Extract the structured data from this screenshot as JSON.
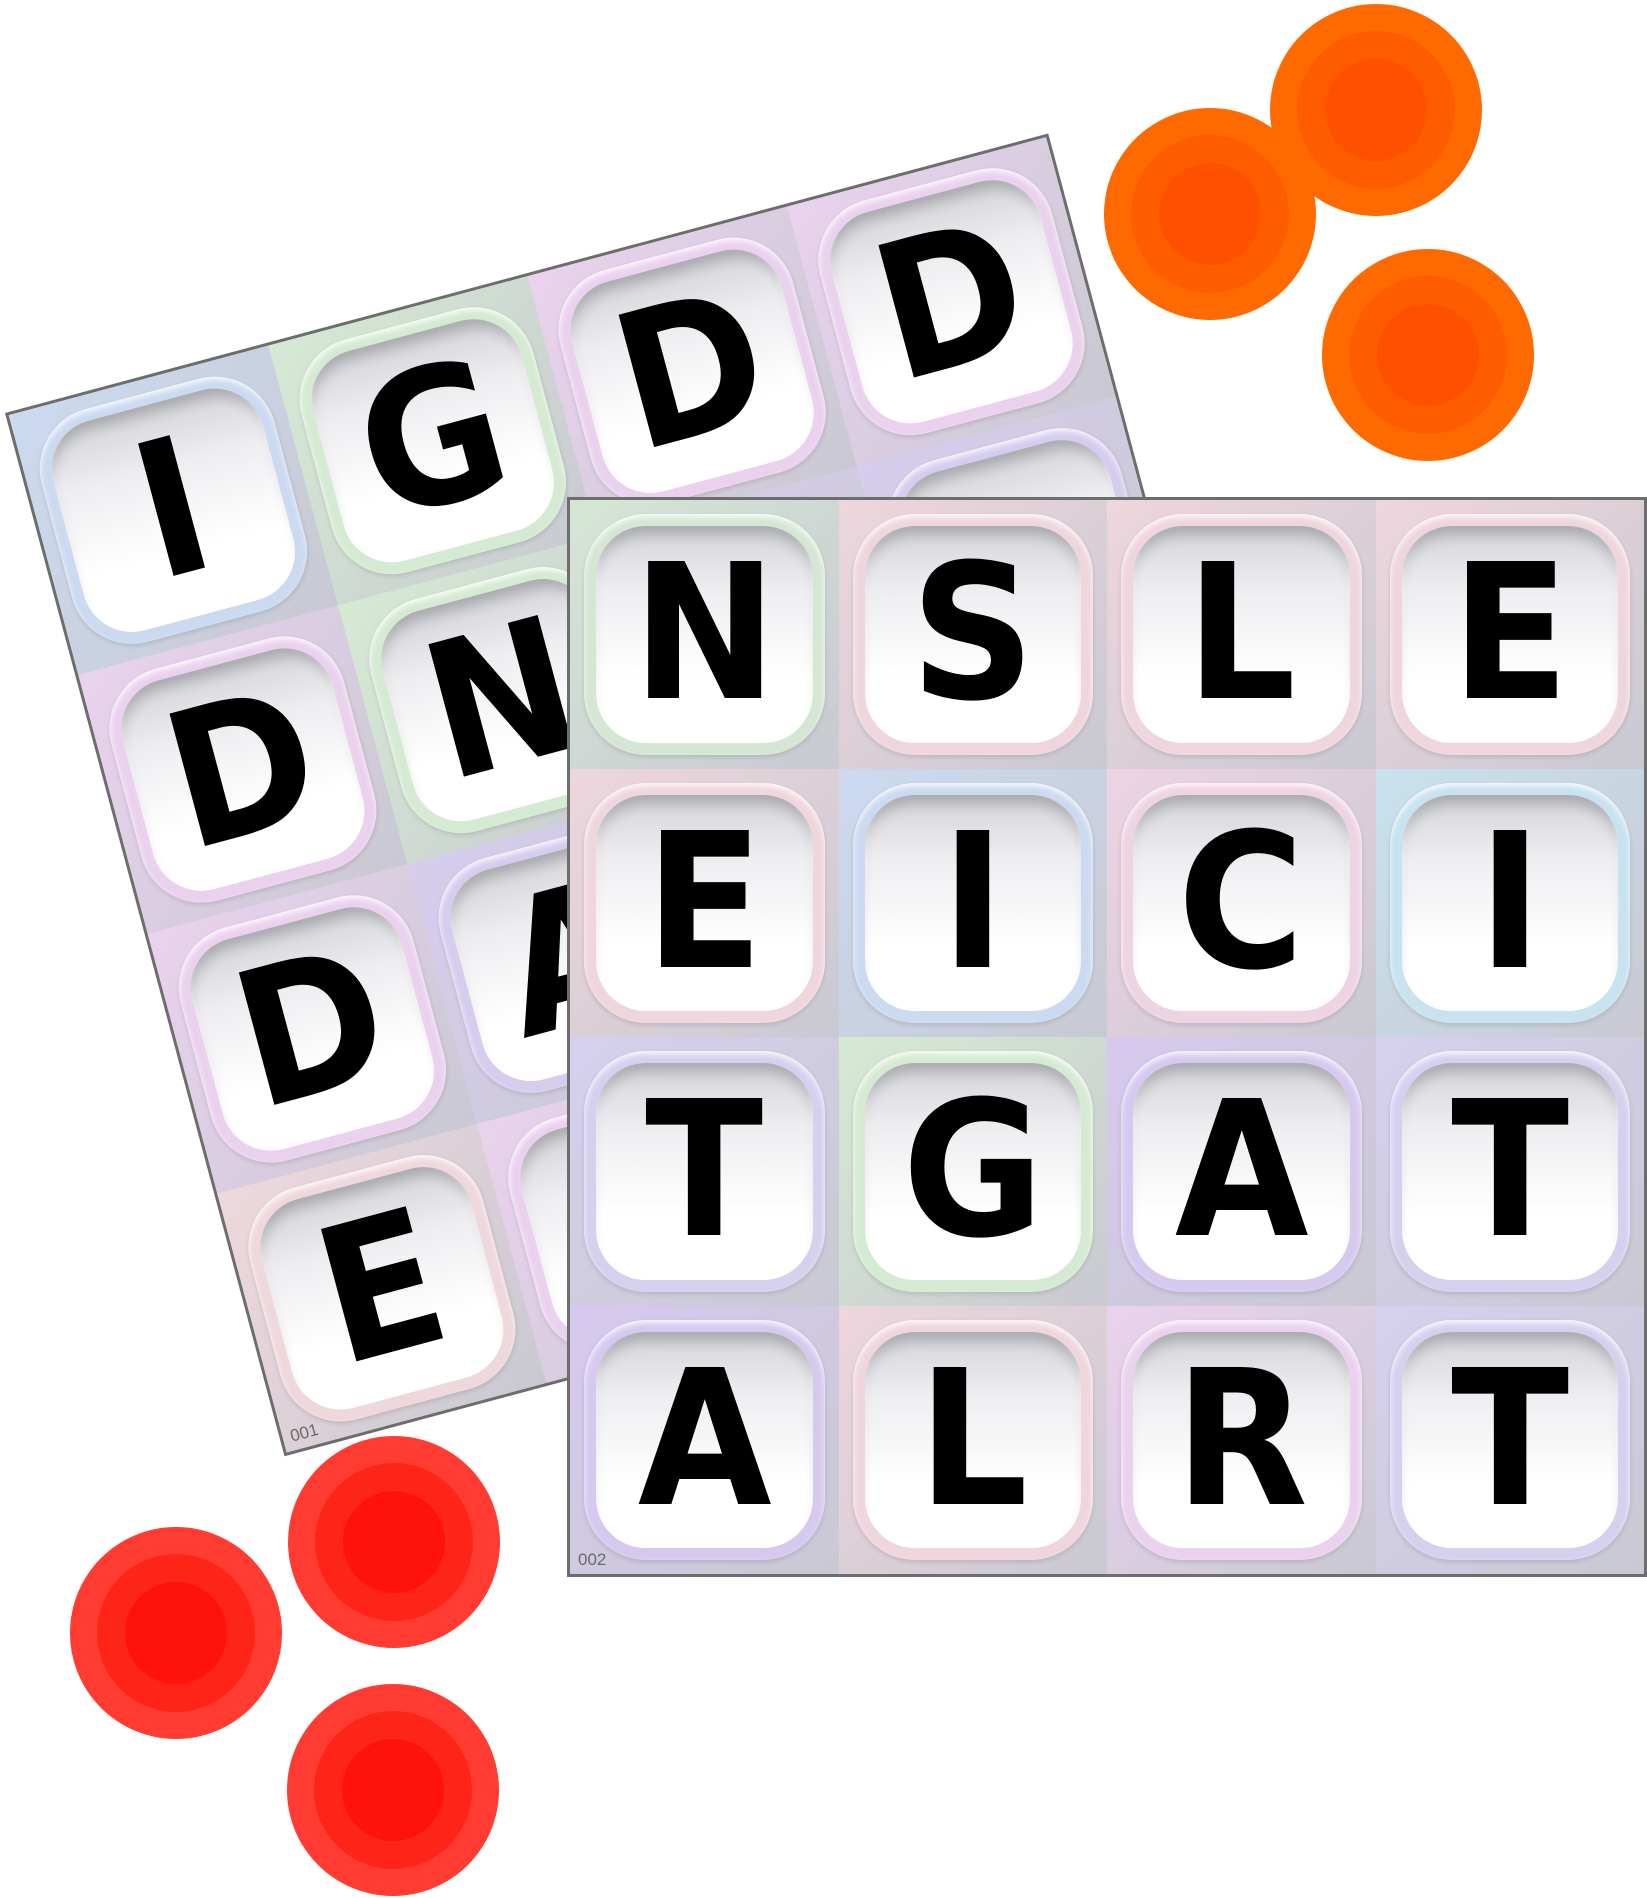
{
  "boards": [
    {
      "number": "001",
      "cells": [
        {
          "letter": "I",
          "color": "#cbdaf0"
        },
        {
          "letter": "G",
          "color": "#d5ead3"
        },
        {
          "letter": "D",
          "color": "#ead2ee"
        },
        {
          "letter": "D",
          "color": "#ead2ee"
        },
        {
          "letter": "D",
          "color": "#ead2ee"
        },
        {
          "letter": "N",
          "color": "#d5ead3"
        },
        {
          "letter": "",
          "color": "#d6cdee"
        },
        {
          "letter": "",
          "color": "#d6cdee"
        },
        {
          "letter": "D",
          "color": "#ead2ee"
        },
        {
          "letter": "A",
          "color": "#d6cdee"
        },
        {
          "letter": "",
          "color": "#e6d9de"
        },
        {
          "letter": "",
          "color": "#d6cdee"
        },
        {
          "letter": "E",
          "color": "#eed8dc"
        },
        {
          "letter": "",
          "color": "#ead2ee"
        },
        {
          "letter": "",
          "color": "#eed8dc"
        },
        {
          "letter": "",
          "color": "#d6cdee"
        }
      ]
    },
    {
      "number": "002",
      "cells": [
        {
          "letter": "N",
          "color": "#d5e6d5"
        },
        {
          "letter": "S",
          "color": "#eed6dc"
        },
        {
          "letter": "L",
          "color": "#eed6dc"
        },
        {
          "letter": "E",
          "color": "#eed6dc"
        },
        {
          "letter": "E",
          "color": "#eed6dc"
        },
        {
          "letter": "I",
          "color": "#cbdaf0"
        },
        {
          "letter": "C",
          "color": "#eed3e3"
        },
        {
          "letter": "I",
          "color": "#c8e2ef"
        },
        {
          "letter": "T",
          "color": "#d6d0ef"
        },
        {
          "letter": "G",
          "color": "#d5ead3"
        },
        {
          "letter": "A",
          "color": "#d6c9ef"
        },
        {
          "letter": "T",
          "color": "#d6d0ef"
        },
        {
          "letter": "A",
          "color": "#d6c9ef"
        },
        {
          "letter": "L",
          "color": "#eed6dc"
        },
        {
          "letter": "R",
          "color": "#ead2ee"
        },
        {
          "letter": "T",
          "color": "#d6d0ef"
        }
      ]
    }
  ],
  "chips": {
    "orange": {
      "outer": "#ff6a00",
      "ring": "#ff5c00",
      "core": "#ff5000"
    },
    "red": {
      "outer": "#ff3b32",
      "ring": "#ff2418",
      "core": "#ff120c"
    }
  }
}
